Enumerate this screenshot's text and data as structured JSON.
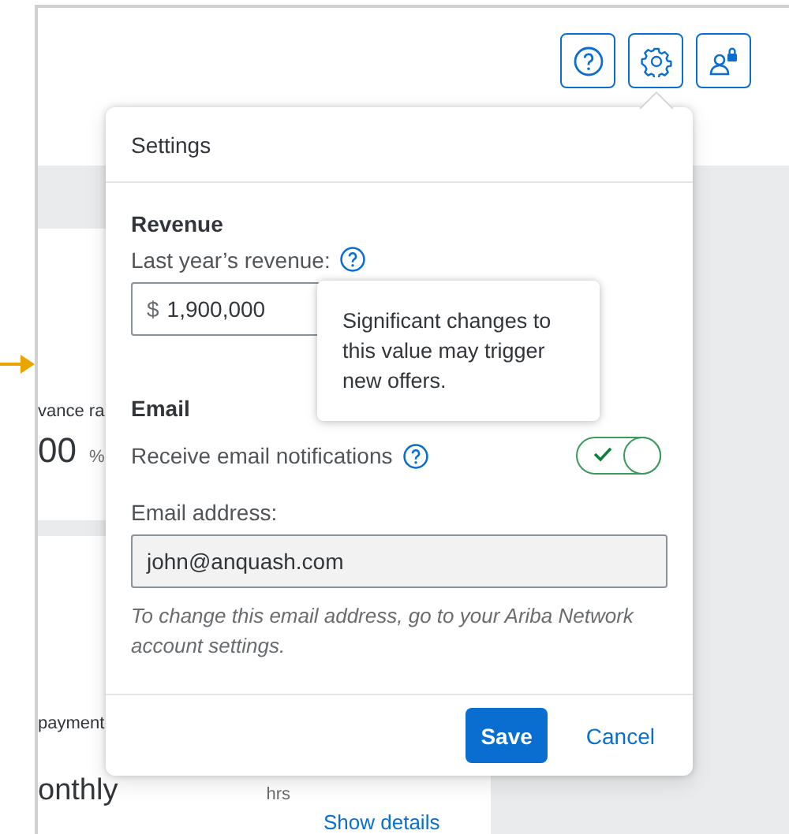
{
  "background": {
    "card_1": {
      "label": "vance ra",
      "value": "00",
      "unit": "%"
    },
    "card_2": {
      "label": "payment",
      "value": "onthly",
      "unit": "hrs",
      "link": "Show details"
    }
  },
  "settings": {
    "title": "Settings",
    "revenue": {
      "heading": "Revenue",
      "field_label": "Last year’s revenue:",
      "currency": "$",
      "value": "1,900,000",
      "tooltip": "Significant changes to this value may trigger new offers."
    },
    "email": {
      "heading": "Email",
      "notifications_label": "Receive email notifications",
      "notifications_on": true,
      "address_label": "Email address:",
      "address": "john@anquash.com",
      "note": "To change this email address, go to your Ariba Network account settings."
    },
    "buttons": {
      "save": "Save",
      "cancel": "Cancel"
    }
  }
}
